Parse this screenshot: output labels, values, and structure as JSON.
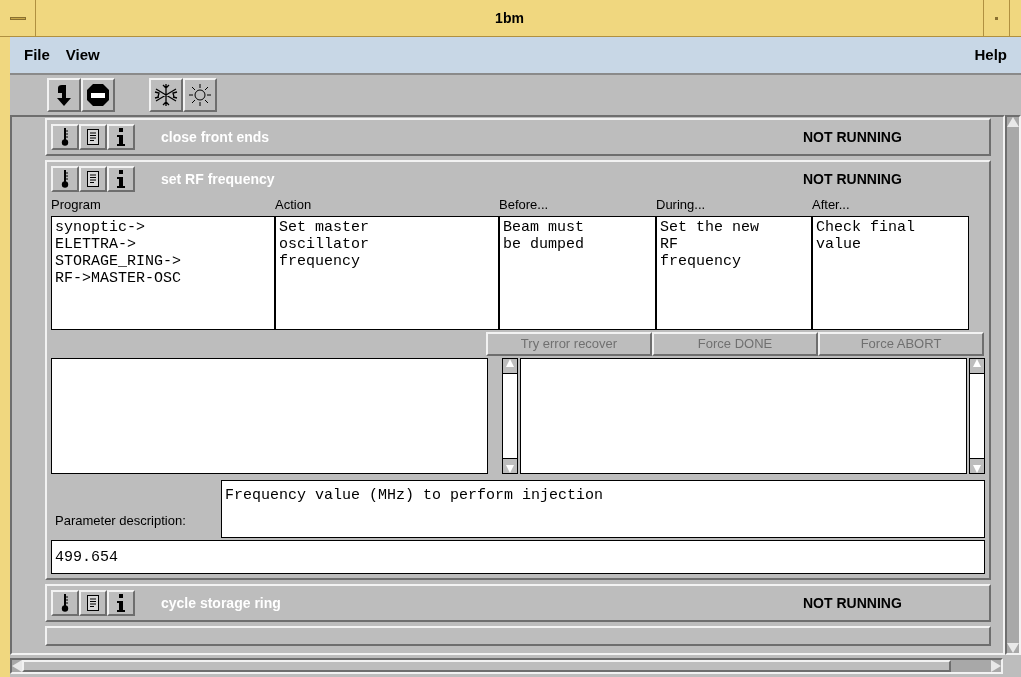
{
  "window": {
    "title": "1bm"
  },
  "menu": [
    {
      "label": "File"
    },
    {
      "label": "View"
    },
    {
      "label": "Help"
    }
  ],
  "toolbar": [
    {
      "kind": "step"
    },
    {
      "kind": "stop"
    },
    {
      "kind": "freeze"
    },
    {
      "kind": "sun"
    }
  ],
  "steps": [
    {
      "name": "close front ends",
      "status": "NOT RUNNING",
      "expanded": false
    },
    {
      "name": "set RF frequency",
      "status": "NOT RUNNING",
      "expanded": true,
      "columns": [
        {
          "header": "Program",
          "text": "synoptic->\nELETTRA->\nSTORAGE_RING->\nRF->MASTER-OSC"
        },
        {
          "header": "Action",
          "text": "Set master\noscillator\nfrequency"
        },
        {
          "header": "Before...",
          "text": "Beam must\nbe dumped"
        },
        {
          "header": "During...",
          "text": "Set the new\nRF\nfrequency"
        },
        {
          "header": "After...",
          "text": "Check final\nvalue"
        }
      ],
      "buttons": [
        {
          "label": "Try error recover",
          "disabled": true
        },
        {
          "label": "Force DONE",
          "disabled": true
        },
        {
          "label": "Force ABORT",
          "disabled": true
        }
      ],
      "parameter": {
        "label": "Parameter description:",
        "description": "Frequency value (MHz) to perform injection",
        "value": "499.654"
      }
    },
    {
      "name": "cycle storage ring",
      "status": "NOT RUNNING",
      "expanded": false
    }
  ]
}
